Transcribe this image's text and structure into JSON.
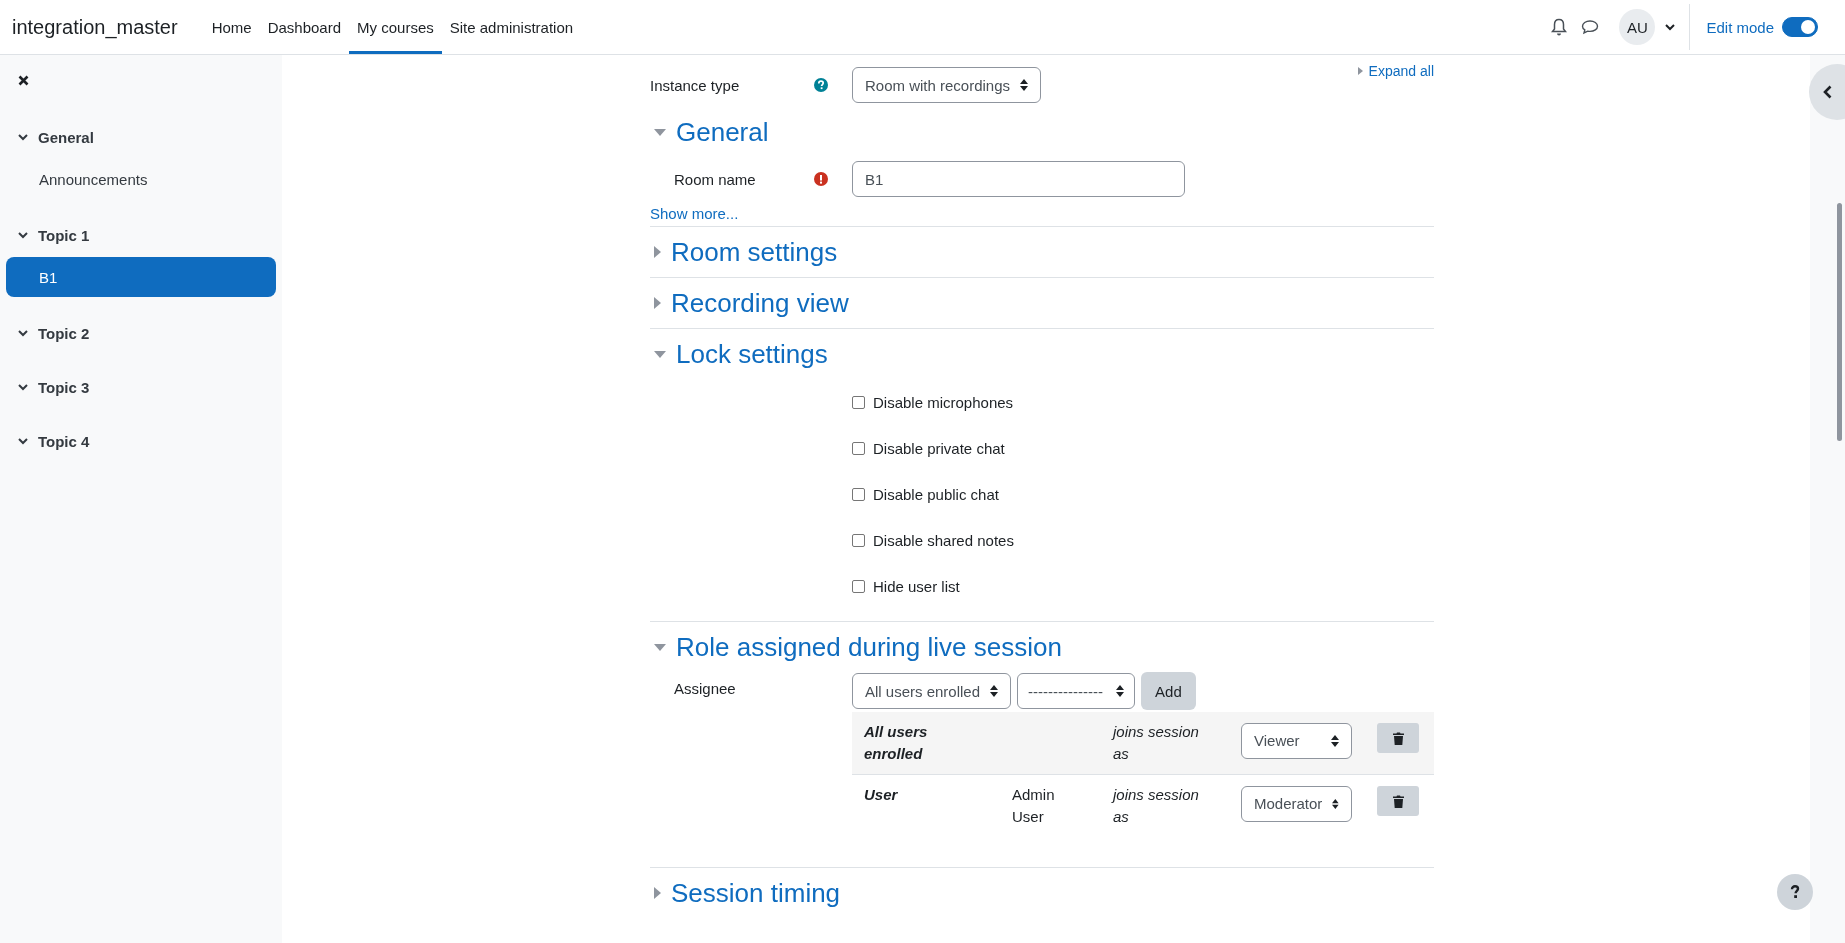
{
  "navbar": {
    "brand": "integration_master",
    "links": [
      {
        "label": "Home",
        "selected": false
      },
      {
        "label": "Dashboard",
        "selected": false
      },
      {
        "label": "My courses",
        "selected": true
      },
      {
        "label": "Site administration",
        "selected": false
      }
    ],
    "avatar": "AU",
    "edit_mode": {
      "label": "Edit mode",
      "on": true
    }
  },
  "sidebar": {
    "items": [
      {
        "label": "General",
        "expanded": true,
        "children": [
          {
            "label": "Announcements",
            "selected": false
          }
        ]
      },
      {
        "label": "Topic 1",
        "expanded": true,
        "children": [
          {
            "label": "B1",
            "selected": true
          }
        ]
      },
      {
        "label": "Topic 2",
        "expanded": true
      },
      {
        "label": "Topic 3",
        "expanded": true
      },
      {
        "label": "Topic 4",
        "expanded": true
      }
    ]
  },
  "form": {
    "expand_all": "Expand all",
    "instance_type": {
      "label": "Instance type",
      "value": "Room with recordings"
    },
    "sections": [
      {
        "kind": "general",
        "title": "General",
        "expanded": true,
        "field": {
          "label": "Room name",
          "value": "B1",
          "required": true
        },
        "show_more": "Show more..."
      },
      {
        "kind": "collapsed",
        "title": "Room settings",
        "expanded": false
      },
      {
        "kind": "collapsed",
        "title": "Recording view",
        "expanded": false
      },
      {
        "kind": "checkboxes",
        "title": "Lock settings",
        "expanded": true,
        "checkboxes": [
          {
            "label": "Disable microphones",
            "checked": false
          },
          {
            "label": "Disable private chat",
            "checked": false
          },
          {
            "label": "Disable public chat",
            "checked": false
          },
          {
            "label": "Disable shared notes",
            "checked": false
          },
          {
            "label": "Hide user list",
            "checked": false
          }
        ]
      },
      {
        "kind": "roles",
        "title": "Role assigned during live session",
        "expanded": true,
        "assignee": {
          "label": "Assignee",
          "type_select": "All users enrolled",
          "user_select": "---------------",
          "add": "Add"
        },
        "rows": [
          {
            "type": "All users enrolled",
            "joins": "joins session as",
            "role": "Viewer"
          },
          {
            "type": "User",
            "name": "Admin User",
            "joins": "joins session as",
            "role": "Moderator"
          }
        ]
      },
      {
        "kind": "collapsed",
        "title": "Session timing",
        "expanded": false
      }
    ]
  }
}
